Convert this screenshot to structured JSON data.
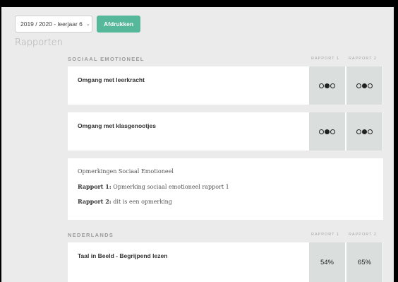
{
  "toolbar": {
    "year_select_value": "2019 / 2020 - leerjaar 6",
    "print_label": "Afdrukken"
  },
  "page_title": "Rapporten",
  "sections": {
    "sociaal": {
      "title": "SOCIAAL EMOTIONEEL",
      "col1": "RAPPORT 1",
      "col2": "RAPPORT 2",
      "rows": [
        {
          "label": "Omgang met leerkracht",
          "rapport1": {
            "filled_index": 1,
            "total": 3
          },
          "rapport2": {
            "filled_index": 1,
            "total": 3
          }
        },
        {
          "label": "Omgang met klasgenootjes",
          "rapport1": {
            "filled_index": 1,
            "total": 3
          },
          "rapport2": {
            "filled_index": 1,
            "total": 3
          }
        }
      ],
      "remarks": {
        "heading": "Opmerkingen Sociaal Emotioneel",
        "r1_tag": "Rapport 1:",
        "r1_text": " Opmerking sociaal emotioneel rapport 1",
        "r2_tag": "Rapport 2:",
        "r2_text": " dit is een opmerking"
      }
    },
    "nederlands": {
      "title": "NEDERLANDS",
      "col1": "RAPPORT 1",
      "col2": "RAPPORT 2",
      "rows": [
        {
          "label": "Taal in Beeld - Begrijpend lezen",
          "rapport1": "54%",
          "rapport2": "65%"
        }
      ]
    }
  }
}
